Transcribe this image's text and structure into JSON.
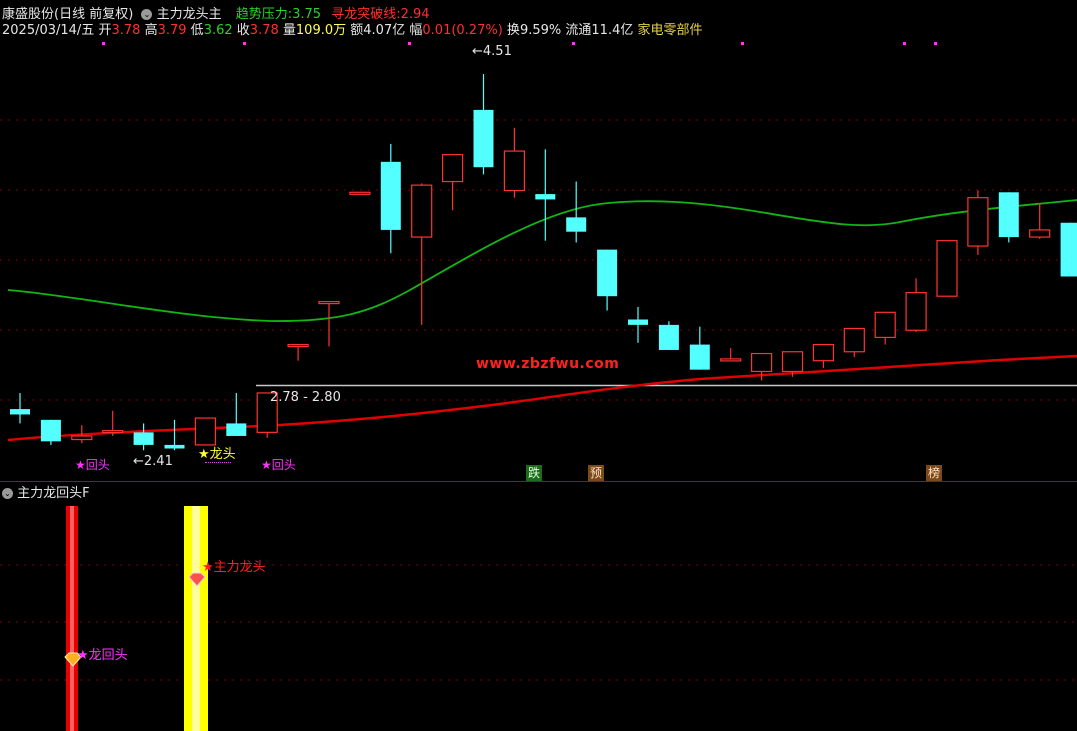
{
  "header": {
    "stock": "康盛股份(日线 前复权)",
    "indicator": "主力龙头主",
    "trend_label": "趋势压力:",
    "trend_value": "3.75",
    "dragon_label": "寻龙突破线:",
    "dragon_value": "2.94"
  },
  "quote": {
    "date": "2025/03/14/五",
    "open_label": "开",
    "open": "3.78",
    "high_label": "高",
    "high": "3.79",
    "low_label": "低",
    "low": "3.62",
    "close_label": "收",
    "close": "3.78",
    "vol_label": "量",
    "vol": "109.0万",
    "amt_label": "额",
    "amt": "4.07亿",
    "chg_label": "幅",
    "chg": "0.01(0.27%)",
    "turn_label": "换",
    "turn": "9.59%",
    "float_label": "流通",
    "float": "11.4亿",
    "sector": "家电零部件"
  },
  "annotations": {
    "high_price": "4.51",
    "low_price": "2.41",
    "range": "2.78 - 2.80",
    "watermark": "www.zbzfwu.com",
    "dragon_head": "★龙头",
    "dragon_return_1": "★回头",
    "dragon_return_2": "★回头",
    "box_die": "跌",
    "box_yu": "预",
    "box_bang": "榜"
  },
  "lower_panel": {
    "title": "主力龙回头F",
    "label_main": "★主力龙头",
    "label_return": "★龙回头"
  },
  "colors": {
    "up": "#ff3232",
    "down": "#54ffff",
    "ma_green": "#14b414",
    "ma_red": "#e00000",
    "magenta": "#ff33ff",
    "yellow": "#ffff33"
  },
  "chart_data": {
    "type": "candlestick",
    "price_range": [
      2.3,
      4.7
    ],
    "candles": [
      {
        "o": 2.64,
        "h": 2.73,
        "l": 2.56,
        "c": 2.61
      },
      {
        "o": 2.58,
        "h": 2.58,
        "l": 2.44,
        "c": 2.46
      },
      {
        "o": 2.47,
        "h": 2.55,
        "l": 2.45,
        "c": 2.49
      },
      {
        "o": 2.51,
        "h": 2.63,
        "l": 2.49,
        "c": 2.52
      },
      {
        "o": 2.51,
        "h": 2.56,
        "l": 2.41,
        "c": 2.44
      },
      {
        "o": 2.44,
        "h": 2.58,
        "l": 2.41,
        "c": 2.42
      },
      {
        "o": 2.44,
        "h": 2.59,
        "l": 2.44,
        "c": 2.59
      },
      {
        "o": 2.56,
        "h": 2.73,
        "l": 2.49,
        "c": 2.49
      },
      {
        "o": 2.51,
        "h": 2.73,
        "l": 2.48,
        "c": 2.73
      },
      {
        "o": 3.0,
        "h": 3.0,
        "l": 2.91,
        "c": 3.0
      },
      {
        "o": 3.24,
        "h": 3.24,
        "l": 2.99,
        "c": 3.24
      },
      {
        "o": 3.85,
        "h": 3.85,
        "l": 3.85,
        "c": 3.85
      },
      {
        "o": 4.02,
        "h": 4.12,
        "l": 3.51,
        "c": 3.64
      },
      {
        "o": 3.6,
        "h": 3.9,
        "l": 3.11,
        "c": 3.89
      },
      {
        "o": 3.91,
        "h": 4.06,
        "l": 3.75,
        "c": 4.06
      },
      {
        "o": 4.31,
        "h": 4.51,
        "l": 3.95,
        "c": 3.99
      },
      {
        "o": 3.86,
        "h": 4.21,
        "l": 3.82,
        "c": 4.08
      },
      {
        "o": 3.84,
        "h": 4.09,
        "l": 3.58,
        "c": 3.81
      },
      {
        "o": 3.71,
        "h": 3.91,
        "l": 3.57,
        "c": 3.63
      },
      {
        "o": 3.53,
        "h": 3.53,
        "l": 3.19,
        "c": 3.27
      },
      {
        "o": 3.14,
        "h": 3.21,
        "l": 3.01,
        "c": 3.11
      },
      {
        "o": 3.11,
        "h": 3.13,
        "l": 3.0,
        "c": 2.97
      },
      {
        "o": 3.0,
        "h": 3.1,
        "l": 2.91,
        "c": 2.86
      },
      {
        "o": 2.92,
        "h": 2.98,
        "l": 2.94,
        "c": 2.92
      },
      {
        "o": 2.85,
        "h": 2.85,
        "l": 2.8,
        "c": 2.95
      },
      {
        "o": 2.85,
        "h": 2.88,
        "l": 2.82,
        "c": 2.96
      },
      {
        "o": 2.91,
        "h": 2.98,
        "l": 2.87,
        "c": 3.0
      },
      {
        "o": 2.96,
        "h": 3.03,
        "l": 2.93,
        "c": 3.09
      },
      {
        "o": 3.04,
        "h": 3.15,
        "l": 3.0,
        "c": 3.18
      },
      {
        "o": 3.08,
        "h": 3.37,
        "l": 3.07,
        "c": 3.29
      },
      {
        "o": 3.27,
        "h": 3.25,
        "l": 3.58,
        "c": 3.58
      },
      {
        "o": 3.55,
        "h": 3.86,
        "l": 3.5,
        "c": 3.82
      },
      {
        "o": 3.85,
        "h": 3.85,
        "l": 3.57,
        "c": 3.6
      },
      {
        "o": 3.6,
        "h": 3.79,
        "l": 3.59,
        "c": 3.64
      },
      {
        "o": 3.68,
        "h": 3.68,
        "l": 3.38,
        "c": 3.38
      },
      {
        "o": 3.48,
        "h": 3.5,
        "l": 3.41,
        "c": 3.43
      }
    ]
  }
}
